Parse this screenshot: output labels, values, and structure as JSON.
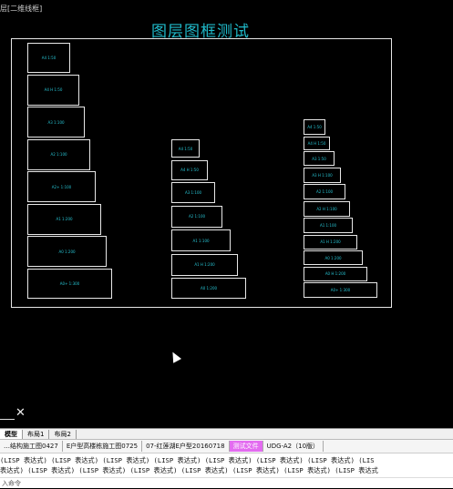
{
  "window": {
    "title_fragment": "层[二维线框]"
  },
  "drawing": {
    "title": "图层图框测试",
    "column_left": [
      {
        "label": "A4 1:50"
      },
      {
        "label": "A4 H 1:50"
      },
      {
        "label": "A3 1:100"
      },
      {
        "label": "A2 1:100"
      },
      {
        "label": "A2+ 1:100"
      },
      {
        "label": "A1 1:200"
      },
      {
        "label": "A0 1:200"
      },
      {
        "label": "A0+ 1:300"
      }
    ],
    "column_middle": [
      {
        "label": "A4 1:50"
      },
      {
        "label": "A4 H 1:50"
      },
      {
        "label": "A3 1:100"
      },
      {
        "label": "A2 1:100"
      },
      {
        "label": "A1 1:100"
      },
      {
        "label": "A1 H 1:200"
      },
      {
        "label": "A0 1:200"
      }
    ],
    "column_right": [
      {
        "label": "A4 1:50"
      },
      {
        "label": "A4 H 1:50"
      },
      {
        "label": "A3 1:50"
      },
      {
        "label": "A3 H 1:100"
      },
      {
        "label": "A2 1:100"
      },
      {
        "label": "A2 H 1:100"
      },
      {
        "label": "A1 1:100"
      },
      {
        "label": "A1 H 1:200"
      },
      {
        "label": "A0 1:200"
      },
      {
        "label": "A0 H 1:200"
      },
      {
        "label": "A0+ 1:300"
      }
    ]
  },
  "layout_tabs": [
    "模型",
    "布局1",
    "布局2"
  ],
  "file_tabs": [
    "…结构施工图0427",
    "E户型高楼栋施工图0725",
    "07-红莲湖E户型20160718",
    "测试文件",
    "UDG-A2（10版）"
  ],
  "active_file_tab": "测试文件",
  "command_history": [
    "(LISP 表达式) (LISP 表达式) (LISP 表达式) (LISP 表达式) (LISP 表达式) (LISP 表达式) (LISP 表达式) (LIS",
    "表达式) (LISP 表达式) (LISP 表达式) (LISP 表达式) (LISP 表达式) (LISP 表达式) (LISP 表达式) (LISP 表达式"
  ],
  "command_prompt": "入命令"
}
